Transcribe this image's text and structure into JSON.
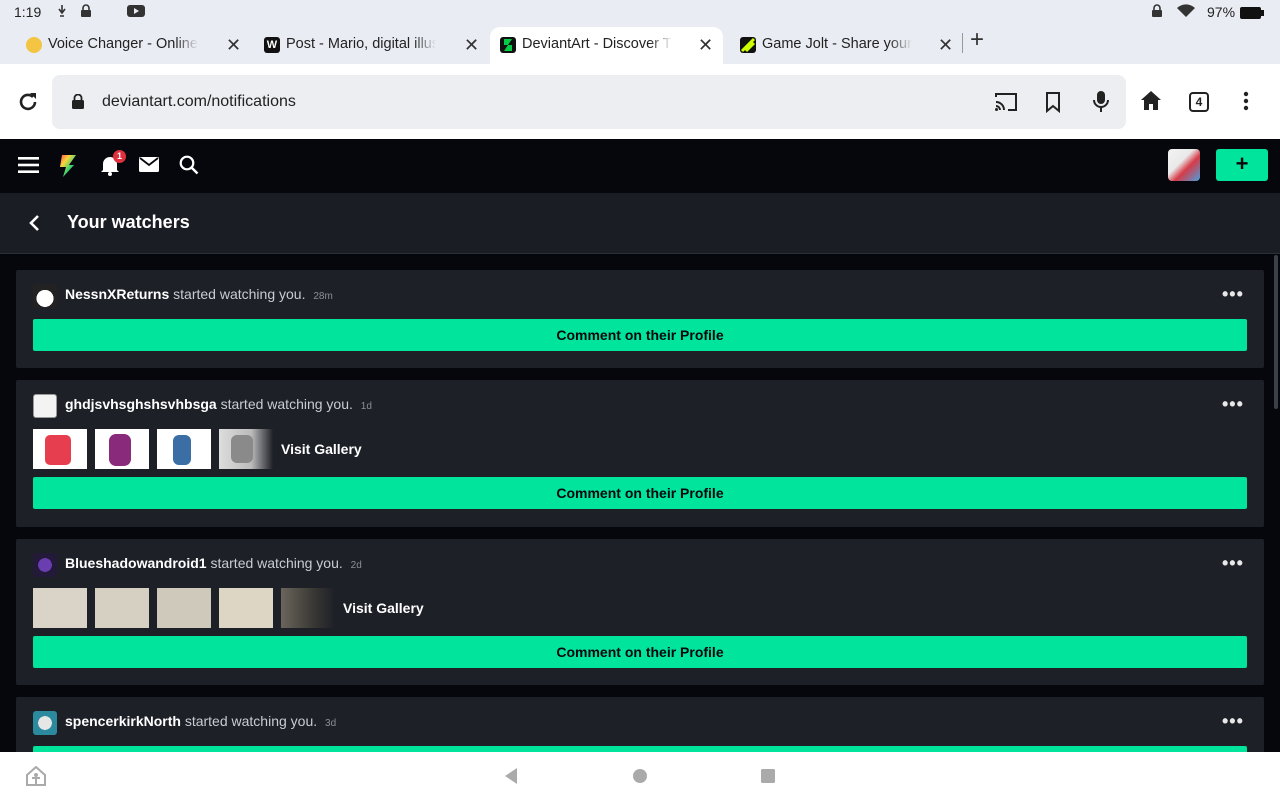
{
  "status_bar": {
    "time": "1:19",
    "battery": "97%"
  },
  "tabs": [
    {
      "title": "Voice Changer - Online & Free",
      "favicon_color": "#f4c542",
      "active": false
    },
    {
      "title": "Post - Mario, digital illustration",
      "favicon_color": "#111111",
      "favicon_letter": "W",
      "active": false
    },
    {
      "title": "DeviantArt - Discover The Largest",
      "favicon_color": "#05cc47",
      "active": true
    },
    {
      "title": "Game Jolt - Share your creations",
      "favicon_color": "#2f7f3a",
      "active": false
    }
  ],
  "toolbar": {
    "url": "deviantart.com/notifications",
    "tab_count": "4"
  },
  "da_header": {
    "notification_count": "1",
    "create_label": "+"
  },
  "page": {
    "title": "Your watchers"
  },
  "cards": [
    {
      "username": "NessnXReturns",
      "action": "started watching you.",
      "ago": "28m",
      "cta": "Comment on their Profile",
      "thumbs": [],
      "visit_label": ""
    },
    {
      "username": "ghdjsvhsghshsvhbsga",
      "action": "started watching you.",
      "ago": "1d",
      "cta": "Comment on their Profile",
      "thumbs": [
        "#e63e4f",
        "#8a2a7a",
        "#3a6ea5",
        "#8a8a8a"
      ],
      "visit_label": "Visit Gallery"
    },
    {
      "username": "Blueshadowandroid1",
      "action": "started watching you.",
      "ago": "2d",
      "cta": "Comment on their Profile",
      "thumbs": [
        "#d9d4c7",
        "#d6d0c3",
        "#cfc9bb",
        "#ddd6c4",
        "#6b655c"
      ],
      "visit_label": "Visit Gallery"
    },
    {
      "username": "spencerkirkNorth",
      "action": "started watching you.",
      "ago": "3d",
      "cta": "",
      "thumbs": [],
      "visit_label": ""
    }
  ],
  "colors": {
    "accent": "#00e59b",
    "page_bg": "#06070d",
    "card_bg": "#1d2027",
    "badge": "#e0303e"
  }
}
